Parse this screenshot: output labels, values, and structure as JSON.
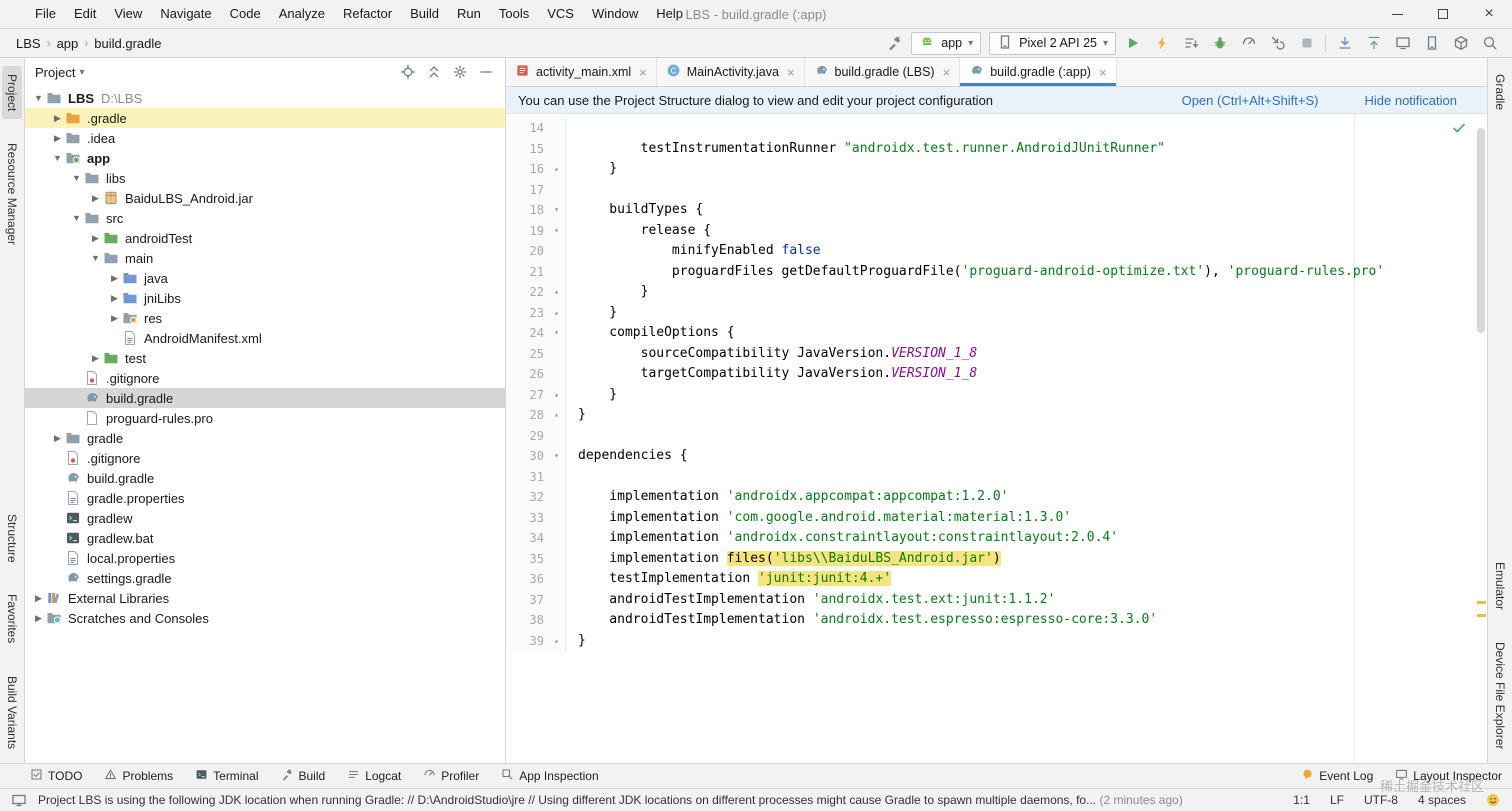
{
  "window": {
    "title": "LBS - build.gradle (:app)",
    "menus": [
      "File",
      "Edit",
      "View",
      "Navigate",
      "Code",
      "Analyze",
      "Refactor",
      "Build",
      "Run",
      "Tools",
      "VCS",
      "Window",
      "Help"
    ]
  },
  "navbar": {
    "breadcrumbs": [
      "LBS",
      "app",
      "build.gradle"
    ],
    "run_config": {
      "label": "app"
    },
    "device": {
      "label": "Pixel 2 API 25"
    },
    "actions": [
      {
        "name": "run-button",
        "icon": "play"
      },
      {
        "name": "apply-changes-button",
        "icon": "bolt"
      },
      {
        "name": "apply-code-changes-button",
        "icon": "boltlist"
      },
      {
        "name": "debug-button",
        "icon": "bug"
      },
      {
        "name": "profile-button",
        "icon": "gauge"
      },
      {
        "name": "attach-debugger-button",
        "icon": "attach"
      },
      {
        "name": "stop-button",
        "icon": "stop"
      }
    ],
    "tools": [
      {
        "name": "update-project-button",
        "icon": "arrowdown"
      },
      {
        "name": "commit-button",
        "icon": "arrowup"
      },
      {
        "name": "layout-inspector-button",
        "icon": "screen"
      },
      {
        "name": "device-manager-button",
        "icon": "phone"
      },
      {
        "name": "sdk-manager-button",
        "icon": "cube"
      },
      {
        "name": "search-everywhere-button",
        "icon": "magnifier"
      }
    ]
  },
  "left_strip": {
    "top": [
      {
        "label": "Project",
        "active": true
      },
      {
        "label": "Resource Manager",
        "active": false
      }
    ],
    "bottom": [
      {
        "label": "Structure",
        "active": false
      },
      {
        "label": "Favorites",
        "active": false
      },
      {
        "label": "Build Variants",
        "active": false
      }
    ]
  },
  "right_strip": {
    "top": [
      {
        "label": "Gradle",
        "active": false
      }
    ],
    "bottom": [
      {
        "label": "Emulator",
        "active": false
      },
      {
        "label": "Device File Explorer",
        "active": false
      }
    ]
  },
  "project": {
    "header": {
      "title": "Project"
    },
    "tree": [
      {
        "label": "LBS",
        "hint": "D:\\LBS",
        "level": 0,
        "icon": "folder",
        "toggle": "open",
        "bold": true
      },
      {
        "label": ".gradle",
        "level": 1,
        "icon": "folder-orange",
        "toggle": "closed",
        "highlight": true
      },
      {
        "label": ".idea",
        "level": 1,
        "icon": "folder",
        "toggle": "closed"
      },
      {
        "label": "app",
        "level": 1,
        "icon": "app-module",
        "toggle": "open",
        "bold": true
      },
      {
        "label": "libs",
        "level": 2,
        "icon": "folder",
        "toggle": "open"
      },
      {
        "label": "BaiduLBS_Android.jar",
        "level": 3,
        "icon": "jar",
        "toggle": "closed"
      },
      {
        "label": "src",
        "level": 2,
        "icon": "folder",
        "toggle": "open"
      },
      {
        "label": "androidTest",
        "level": 3,
        "icon": "folder-green",
        "toggle": "closed"
      },
      {
        "label": "main",
        "level": 3,
        "icon": "folder",
        "toggle": "open"
      },
      {
        "label": "java",
        "level": 4,
        "icon": "folder-blue",
        "toggle": "closed"
      },
      {
        "label": "jniLibs",
        "level": 4,
        "icon": "folder-blue",
        "toggle": "closed"
      },
      {
        "label": "res",
        "level": 4,
        "icon": "folder-res",
        "toggle": "closed"
      },
      {
        "label": "AndroidManifest.xml",
        "level": 4,
        "icon": "manifest",
        "toggle": "none"
      },
      {
        "label": "test",
        "level": 3,
        "icon": "folder-green",
        "toggle": "closed"
      },
      {
        "label": ".gitignore",
        "level": 2,
        "icon": "git-file",
        "toggle": "none"
      },
      {
        "label": "build.gradle",
        "level": 2,
        "icon": "gradle",
        "toggle": "none",
        "selected": true
      },
      {
        "label": "proguard-rules.pro",
        "level": 2,
        "icon": "file",
        "toggle": "none"
      },
      {
        "label": "gradle",
        "level": 1,
        "icon": "folder",
        "toggle": "closed"
      },
      {
        "label": ".gitignore",
        "level": 1,
        "icon": "git-file",
        "toggle": "none"
      },
      {
        "label": "build.gradle",
        "level": 1,
        "icon": "gradle",
        "toggle": "none"
      },
      {
        "label": "gradle.properties",
        "level": 1,
        "icon": "properties",
        "toggle": "none"
      },
      {
        "label": "gradlew",
        "level": 1,
        "icon": "console",
        "toggle": "none"
      },
      {
        "label": "gradlew.bat",
        "level": 1,
        "icon": "console",
        "toggle": "none"
      },
      {
        "label": "local.properties",
        "level": 1,
        "icon": "properties",
        "toggle": "none"
      },
      {
        "label": "settings.gradle",
        "level": 1,
        "icon": "gradle",
        "toggle": "none"
      },
      {
        "label": "External Libraries",
        "level": 0,
        "icon": "library",
        "toggle": "closed"
      },
      {
        "label": "Scratches and Consoles",
        "level": 0,
        "icon": "scratches",
        "toggle": "closed"
      }
    ]
  },
  "editor": {
    "tabs": [
      {
        "label": "activity_main.xml",
        "icon": "layoutxml",
        "active": false
      },
      {
        "label": "MainActivity.java",
        "icon": "java-class",
        "active": false
      },
      {
        "label": "build.gradle (LBS)",
        "icon": "gradle",
        "active": false
      },
      {
        "label": "build.gradle (:app)",
        "icon": "gradle",
        "active": true
      }
    ],
    "notification": {
      "text": "You can use the Project Structure dialog to view and edit your project configuration",
      "open_label": "Open (Ctrl+Alt+Shift+S)",
      "hide_label": "Hide notification"
    },
    "code": {
      "lines": [
        {
          "n": 14,
          "segs": []
        },
        {
          "n": 15,
          "segs": [
            {
              "t": "        testInstrumentationRunner ",
              "c": "plain"
            },
            {
              "t": "\"androidx.test.runner.AndroidJUnitRunner\"",
              "c": "string"
            }
          ]
        },
        {
          "n": 16,
          "fold": "up",
          "segs": [
            {
              "t": "    }",
              "c": "plain"
            }
          ]
        },
        {
          "n": 17,
          "segs": []
        },
        {
          "n": 18,
          "fold": "down",
          "segs": [
            {
              "t": "    buildTypes {",
              "c": "plain"
            }
          ]
        },
        {
          "n": 19,
          "fold": "down",
          "segs": [
            {
              "t": "        release {",
              "c": "plain"
            }
          ]
        },
        {
          "n": 20,
          "segs": [
            {
              "t": "            minifyEnabled ",
              "c": "plain"
            },
            {
              "t": "false",
              "c": "keyword"
            }
          ]
        },
        {
          "n": 21,
          "segs": [
            {
              "t": "            proguardFiles getDefaultProguardFile(",
              "c": "plain"
            },
            {
              "t": "'proguard-android-optimize.txt'",
              "c": "string"
            },
            {
              "t": "), ",
              "c": "plain"
            },
            {
              "t": "'proguard-rules.pro'",
              "c": "string"
            }
          ]
        },
        {
          "n": 22,
          "fold": "up",
          "segs": [
            {
              "t": "        }",
              "c": "plain"
            }
          ]
        },
        {
          "n": 23,
          "fold": "up",
          "segs": [
            {
              "t": "    }",
              "c": "plain"
            }
          ]
        },
        {
          "n": 24,
          "fold": "down",
          "segs": [
            {
              "t": "    compileOptions {",
              "c": "plain"
            }
          ]
        },
        {
          "n": 25,
          "segs": [
            {
              "t": "        sourceCompatibility JavaVersion.",
              "c": "plain"
            },
            {
              "t": "VERSION_1_8",
              "c": "const"
            }
          ]
        },
        {
          "n": 26,
          "segs": [
            {
              "t": "        targetCompatibility JavaVersion.",
              "c": "plain"
            },
            {
              "t": "VERSION_1_8",
              "c": "const"
            }
          ]
        },
        {
          "n": 27,
          "fold": "up",
          "segs": [
            {
              "t": "    }",
              "c": "plain"
            }
          ]
        },
        {
          "n": 28,
          "fold": "up",
          "segs": [
            {
              "t": "}",
              "c": "plain"
            }
          ]
        },
        {
          "n": 29,
          "segs": []
        },
        {
          "n": 30,
          "fold": "down",
          "segs": [
            {
              "t": "dependencies {",
              "c": "plain"
            }
          ]
        },
        {
          "n": 31,
          "segs": []
        },
        {
          "n": 32,
          "segs": [
            {
              "t": "    implementation ",
              "c": "plain"
            },
            {
              "t": "'androidx.appcompat:appcompat:1.2.0'",
              "c": "string"
            }
          ]
        },
        {
          "n": 33,
          "segs": [
            {
              "t": "    implementation ",
              "c": "plain"
            },
            {
              "t": "'com.google.android.material:material:1.3.0'",
              "c": "string"
            }
          ]
        },
        {
          "n": 34,
          "segs": [
            {
              "t": "    implementation ",
              "c": "plain"
            },
            {
              "t": "'androidx.constraintlayout:constraintlayout:2.0.4'",
              "c": "string"
            }
          ]
        },
        {
          "n": 35,
          "segs": [
            {
              "t": "    implementation ",
              "c": "plain"
            },
            {
              "t": "files(",
              "c": "hl"
            },
            {
              "t": "'libs\\\\BaiduLBS_Android.jar'",
              "c": "hl-string"
            },
            {
              "t": ")",
              "c": "hl"
            }
          ]
        },
        {
          "n": 36,
          "segs": [
            {
              "t": "    testImplementation ",
              "c": "plain"
            },
            {
              "t": "'junit:junit:4.+'",
              "c": "hl-string"
            }
          ]
        },
        {
          "n": 37,
          "segs": [
            {
              "t": "    androidTestImplementation ",
              "c": "plain"
            },
            {
              "t": "'androidx.test.ext:junit:1.1.2'",
              "c": "string"
            }
          ]
        },
        {
          "n": 38,
          "segs": [
            {
              "t": "    androidTestImplementation ",
              "c": "plain"
            },
            {
              "t": "'androidx.test.espresso:espresso-core:3.3.0'",
              "c": "string"
            }
          ]
        },
        {
          "n": 39,
          "fold": "up",
          "segs": [
            {
              "t": "}",
              "c": "plain"
            }
          ]
        }
      ]
    }
  },
  "bottom_bar": {
    "left": [
      {
        "label": "TODO",
        "icon": "todo"
      },
      {
        "label": "Problems",
        "icon": "warn"
      },
      {
        "label": "Terminal",
        "icon": "console"
      },
      {
        "label": "Build",
        "icon": "hammer"
      },
      {
        "label": "Logcat",
        "icon": "lines"
      },
      {
        "label": "Profiler",
        "icon": "gauge"
      },
      {
        "label": "App Inspection",
        "icon": "inspectbox"
      }
    ],
    "right": [
      {
        "label": "Event Log",
        "icon": "balloon"
      },
      {
        "label": "Layout Inspector",
        "icon": "screen"
      }
    ]
  },
  "status_bar": {
    "message": "Project LBS is using the following JDK location when running Gradle: // D:\\AndroidStudio\\jre // Using different JDK locations on different processes might cause Gradle to spawn multiple daemons, fo...",
    "time": "(2 minutes ago)",
    "items": [
      "1:1",
      "LF",
      "UTF-8",
      "4 spaces"
    ]
  },
  "watermark": "稀土掘金技术社区"
}
